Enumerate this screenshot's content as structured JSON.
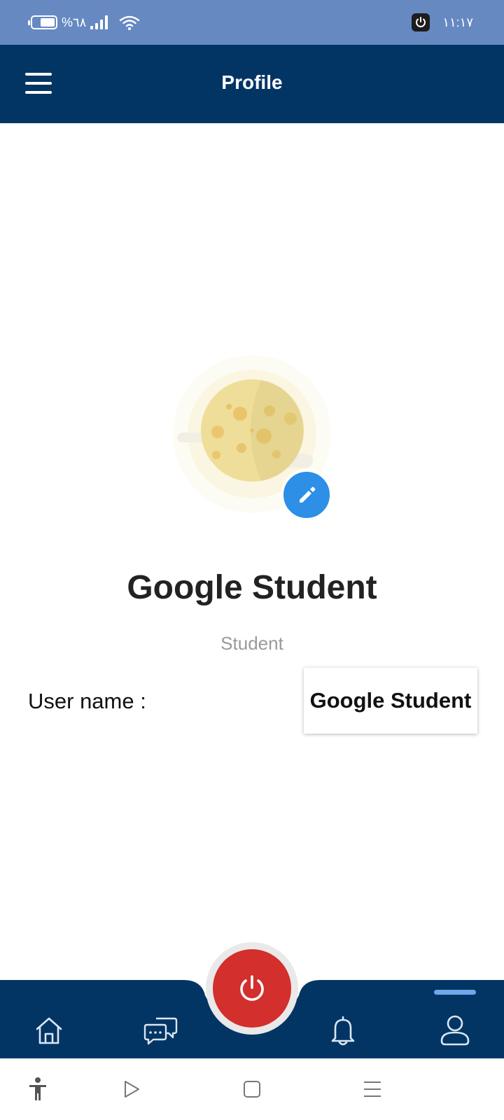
{
  "status_bar": {
    "battery_text": "%٦٨",
    "battery_level": 0.68,
    "time": "١١:١٧",
    "icons": [
      "battery-icon",
      "signal-icon",
      "wifi-icon",
      "power-notification-icon"
    ]
  },
  "header": {
    "title": "Profile",
    "menu_icon": "hamburger-menu-icon"
  },
  "profile": {
    "name": "Google Student",
    "role": "Student",
    "avatar_icon": "moon-avatar-image",
    "edit_icon": "pencil-icon"
  },
  "fields": {
    "username_label": "User name :",
    "username_value": "Google Student"
  },
  "bottom_nav": {
    "items": [
      {
        "icon": "home-icon"
      },
      {
        "icon": "chat-icon"
      },
      {
        "icon": "power-icon"
      },
      {
        "icon": "bell-icon"
      },
      {
        "icon": "profile-icon",
        "active": true
      }
    ]
  },
  "system_nav": {
    "icons": [
      "accessibility-icon",
      "play-icon",
      "square-icon",
      "menu-lines-icon"
    ]
  },
  "colors": {
    "status_bar": "#6689c1",
    "header": "#033564",
    "nav": "#033564",
    "power_button": "#d22f2d",
    "edit_button": "#2d8fe6",
    "active_indicator": "#6fa8ea"
  }
}
